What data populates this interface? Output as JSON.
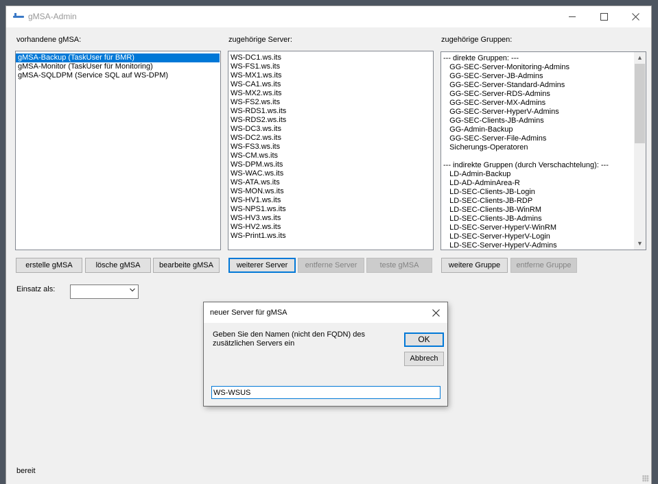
{
  "window": {
    "title": "gMSA-Admin"
  },
  "labels": {
    "gmsa": "vorhandene gMSA:",
    "servers": "zugehörige Server:",
    "groups": "zugehörige Gruppen:",
    "einsatz": "Einsatz als:"
  },
  "gmsa_list": [
    "gMSA-Backup (TaskUser für BMR)",
    "gMSA-Monitor (TaskUser für Monitoring)",
    "gMSA-SQLDPM (Service SQL auf WS-DPM)"
  ],
  "gmsa_selected_index": 0,
  "server_list": [
    "WS-DC1.ws.its",
    "WS-FS1.ws.its",
    "WS-MX1.ws.its",
    "WS-CA1.ws.its",
    "WS-MX2.ws.its",
    "WS-FS2.ws.its",
    "WS-RDS1.ws.its",
    "WS-RDS2.ws.its",
    "WS-DC3.ws.its",
    "WS-DC2.ws.its",
    "WS-FS3.ws.its",
    "WS-CM.ws.its",
    "WS-DPM.ws.its",
    "WS-WAC.ws.its",
    "WS-ATA.ws.its",
    "WS-MON.ws.its",
    "WS-HV1.ws.its",
    "WS-NPS1.ws.its",
    "WS-HV3.ws.its",
    "WS-HV2.ws.its",
    "WS-Print1.ws.its"
  ],
  "group_list": [
    "--- direkte Gruppen: ---",
    "   GG-SEC-Server-Monitoring-Admins",
    "   GG-SEC-Server-JB-Admins",
    "   GG-SEC-Server-Standard-Admins",
    "   GG-SEC-Server-RDS-Admins",
    "   GG-SEC-Server-MX-Admins",
    "   GG-SEC-Server-HyperV-Admins",
    "   GG-SEC-Clients-JB-Admins",
    "   GG-Admin-Backup",
    "   GG-SEC-Server-File-Admins",
    "   Sicherungs-Operatoren",
    "",
    "--- indirekte Gruppen (durch Verschachtelung): ---",
    "   LD-Admin-Backup",
    "   LD-AD-AdminArea-R",
    "   LD-SEC-Clients-JB-Login",
    "   LD-SEC-Clients-JB-RDP",
    "   LD-SEC-Clients-JB-WinRM",
    "   LD-SEC-Clients-JB-Admins",
    "   LD-SEC-Server-HyperV-WinRM",
    "   LD-SEC-Server-HyperV-Login",
    "   LD-SEC-Server-HyperV-Admins"
  ],
  "buttons": {
    "create_gmsa": "erstelle gMSA",
    "delete_gmsa": "lösche gMSA",
    "edit_gmsa": "bearbeite gMSA",
    "add_server": "weiterer Server",
    "remove_server": "entferne Server",
    "test_gmsa": "teste gMSA",
    "add_group": "weitere Gruppe",
    "remove_group": "entferne Gruppe"
  },
  "einsatz_value": "",
  "status": "bereit",
  "dialog": {
    "title": "neuer Server für gMSA",
    "message": "Geben Sie den Namen (nicht den FQDN) des zusätzlichen Servers ein",
    "ok": "OK",
    "cancel": "Abbrech",
    "input_value": "WS-WSUS"
  },
  "colors": {
    "selection": "#0078d7",
    "desktop": "#4d5560"
  },
  "icons": {
    "close": "close-icon",
    "minimize": "minimize-icon",
    "maximize": "maximize-icon",
    "dropdown": "chevron-down-icon"
  }
}
